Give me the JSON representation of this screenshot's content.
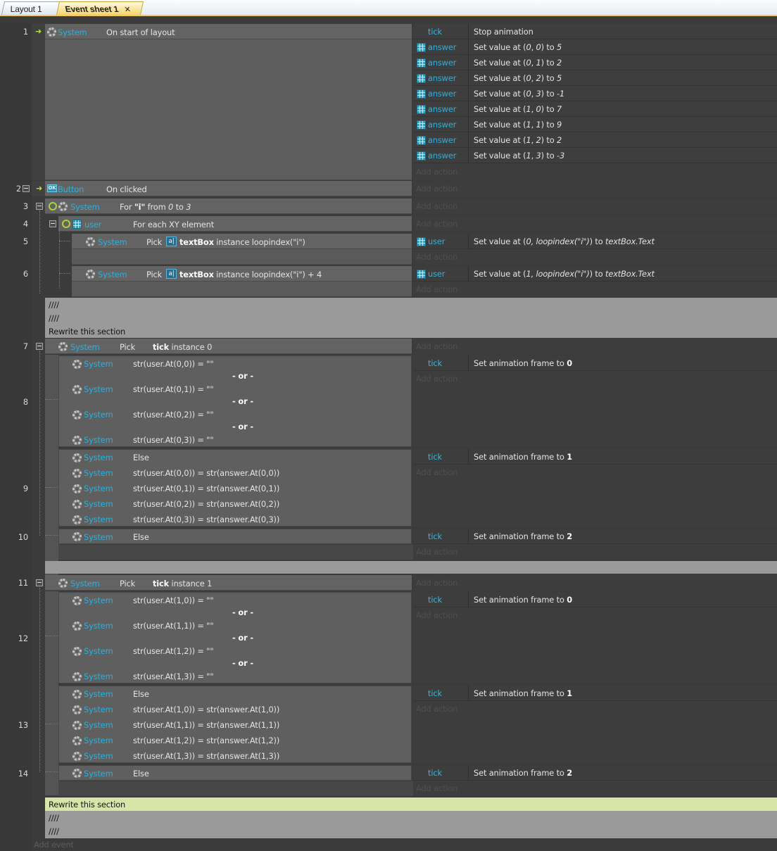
{
  "tabs": [
    {
      "label": "Layout 1",
      "active": false
    },
    {
      "label": "Event sheet 1",
      "active": true,
      "close": "✕"
    }
  ],
  "common": {
    "system": "System",
    "add_action": "Add action",
    "add_event": "Add event",
    "or": "- or -",
    "else": "Else",
    "pick": "Pick",
    "tick": "tick",
    "answer": "answer",
    "user": "user",
    "button": "Button",
    "textbox": "textBox"
  },
  "e1": {
    "num": "1",
    "condition": "On start of layout",
    "first_action": "Stop animation",
    "actions": [
      {
        "a": "0",
        "b": "0",
        "v": "5"
      },
      {
        "a": "0",
        "b": "1",
        "v": "2"
      },
      {
        "a": "0",
        "b": "2",
        "v": "5"
      },
      {
        "a": "0",
        "b": "3",
        "v": "-1"
      },
      {
        "a": "1",
        "b": "0",
        "v": "7"
      },
      {
        "a": "1",
        "b": "1",
        "v": "9"
      },
      {
        "a": "1",
        "b": "2",
        "v": "2"
      },
      {
        "a": "1",
        "b": "3",
        "v": "-3"
      }
    ]
  },
  "e2": {
    "num": "2",
    "condition": "On clicked"
  },
  "e3": {
    "num": "3",
    "prefix": "For ",
    "var": "\"i\"",
    "from": " from ",
    "start": "0",
    "to": " to ",
    "end": "3"
  },
  "e4": {
    "num": "4",
    "condition": "For each XY element"
  },
  "e5": {
    "num": "5",
    "suffix": " instance loopindex(\"i\")",
    "action_pre": "Set value at (",
    "action_x": "0, loopindex(\"i\")",
    "action_mid": ") to ",
    "action_val": "textBox.Text"
  },
  "e6": {
    "num": "6",
    "suffix": " instance loopindex(\"i\") + 4",
    "action_pre": "Set value at (",
    "action_x": "1, loopindex(\"i\")",
    "action_mid": ") to ",
    "action_val": "textBox.Text"
  },
  "comment1": {
    "line1": "////",
    "line2": "////",
    "line3": "Rewrite this section"
  },
  "e7": {
    "num": "7",
    "suffix": " instance 0"
  },
  "e8": {
    "num": "8",
    "conds": [
      "str(user.At(0,0)) = \"\"",
      "str(user.At(0,1)) = \"\"",
      "str(user.At(0,2)) = \"\"",
      "str(user.At(0,3)) = \"\""
    ],
    "action": "Set animation frame to ",
    "frame": "0"
  },
  "e9": {
    "num": "9",
    "conds": [
      "str(user.At(0,0)) = str(answer.At(0,0))",
      "str(user.At(0,1)) = str(answer.At(0,1))",
      "str(user.At(0,2)) = str(answer.At(0,2))",
      "str(user.At(0,3)) = str(answer.At(0,3))"
    ],
    "action": "Set animation frame to ",
    "frame": "1"
  },
  "e10": {
    "num": "10",
    "action": "Set animation frame to ",
    "frame": "2"
  },
  "e11": {
    "num": "11",
    "suffix": " instance 1"
  },
  "e12": {
    "num": "12",
    "conds": [
      "str(user.At(1,0)) = \"\"",
      "str(user.At(1,1)) = \"\"",
      "str(user.At(1,2)) = \"\"",
      "str(user.At(1,3)) = \"\""
    ],
    "action": "Set animation frame to ",
    "frame": "0"
  },
  "e13": {
    "num": "13",
    "conds": [
      "str(user.At(1,0)) = str(answer.At(1,0))",
      "str(user.At(1,1)) = str(answer.At(1,1))",
      "str(user.At(1,2)) = str(answer.At(1,2))",
      "str(user.At(1,3)) = str(answer.At(1,3))"
    ],
    "action": "Set animation frame to ",
    "frame": "1"
  },
  "e14": {
    "num": "14",
    "action": "Set animation frame to ",
    "frame": "2"
  },
  "comment2": {
    "line1": "Rewrite this section",
    "line2": "////",
    "line3": "////",
    "highlight": "#d8e4a8"
  },
  "colors": {
    "background": "#3b3b3b",
    "condition_block": "#636363",
    "object_name": "#2bb2dd",
    "comment": "#9a9a9a",
    "tab_active": "#f7d56c"
  }
}
